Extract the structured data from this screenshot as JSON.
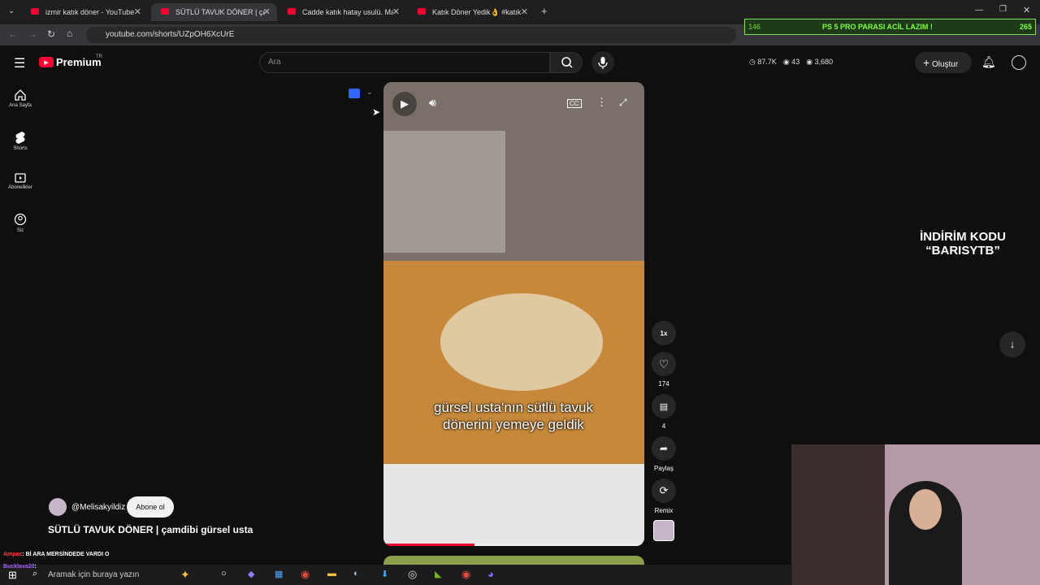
{
  "browser": {
    "tabs": [
      {
        "title": "izmir katık döner - YouTube"
      },
      {
        "title": "SÜTLÜ TAVUK DÖNER | çamdib"
      },
      {
        "title": "Cadde katık hatay usulü. Marka"
      },
      {
        "title": "Katık Döner Yedik👌 #katık #dö"
      }
    ],
    "url": "youtube.com/shorts/UZpOH6XcUrE"
  },
  "stream_banner": {
    "left_count": "146",
    "text": "PS 5 PRO PARASI ACİL LAZIM !",
    "right_count": "265"
  },
  "header": {
    "logo_text": "Premium",
    "region": "TR",
    "search_placeholder": "Ara",
    "stats": {
      "a": "87.7K",
      "b": "43",
      "c": "3,680"
    },
    "create_label": "Oluştur"
  },
  "sidebar": {
    "items": [
      {
        "label": "Ana Sayfa"
      },
      {
        "label": "Shorts"
      },
      {
        "label": "Abonelikler"
      },
      {
        "label": "Siz"
      }
    ]
  },
  "video": {
    "caption": "gürsel usta'nın sütlü tavuk dönerini yemeye geldik",
    "channel": "@Melisakyildiz",
    "subscribe_label": "Abone ol",
    "title": "SÜTLÜ TAVUK DÖNER | çamdibi gürsel usta",
    "speed": "1x"
  },
  "actions": {
    "likes": "174",
    "comments": "4",
    "share": "Paylaş",
    "remix": "Remix"
  },
  "promo": {
    "line1": "İNDİRİM KODU",
    "line2": "“BARISYTB”"
  },
  "chat": [
    {
      "user": "Ampac",
      "message": ": Bİ ARA MERSİNDEDE VARDI O"
    },
    {
      "user": "Bucklava20",
      "message": ":"
    }
  ],
  "taskbar": {
    "search_placeholder": "Aramak için buraya yazın"
  },
  "colors": {
    "brand": "#ff0033",
    "banner": "#7fff3a"
  }
}
